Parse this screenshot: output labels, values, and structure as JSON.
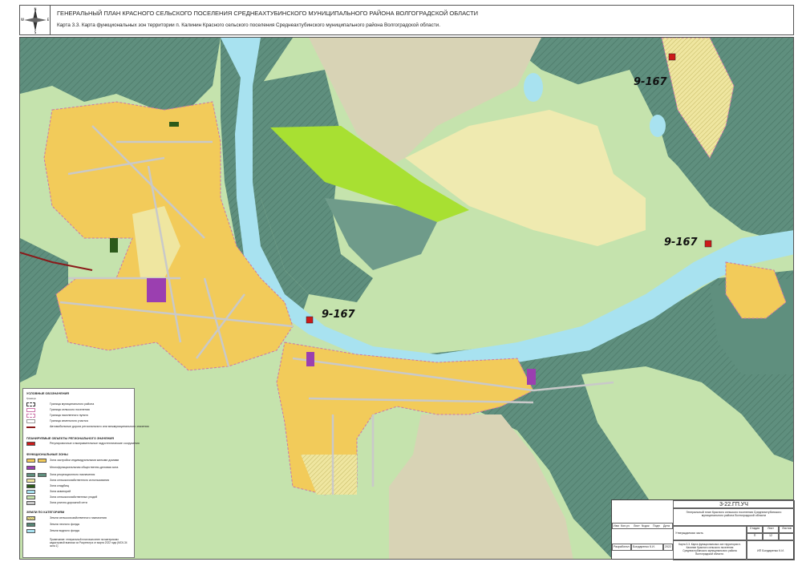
{
  "header": {
    "title": "ГЕНЕРАЛЬНЫЙ ПЛАН КРАСНОГО СЕЛЬСКОГО ПОСЕЛЕНИЯ СРЕДНЕАХТУБИНСКОГО МУНИЦИПАЛЬНОГО РАЙОНА ВОЛГОГРАДСКОЙ ОБЛАСТИ",
    "subtitle": "Карта 3.3. Карта функциональных зон территории п. Калинин Красного сельского поселения Среднеахтубинского муниципального района Волгоградской области."
  },
  "compass": {
    "n": "N",
    "s": "S",
    "e": "E",
    "w": "W"
  },
  "road_labels": [
    "9-167",
    "9-167",
    "9-167"
  ],
  "legend": {
    "title": "УСЛОВНЫЕ ОБОЗНАЧЕНИЯ",
    "sub": "Граница",
    "boundaries": [
      "Граница муниципального района",
      "Граница сельского поселения",
      "Граница населенного пункта",
      "Граница земельного участка",
      "Автомобильные дороги регионального или межмуниципального значения"
    ],
    "planned_title": "ПЛАНИРУЕМЫЕ ОБЪЕКТЫ РЕГИОНАЛЬНОГО ЗНАЧЕНИЯ",
    "planned": [
      "Регулировочные и выправительные гидротехнические сооружения"
    ],
    "zones_title": "ФУНКЦИОНАЛЬНЫЕ ЗОНЫ",
    "zones": [
      "Зона застройки индивидуальными жилыми домами",
      "Многофункциональная общественно-деловая зона",
      "Зона рекреационного назначения",
      "Зона сельскохозяйственного использования",
      "Зона кладбищ",
      "Зона акваторий",
      "Зона сельскохозяйственных угодий",
      "Зона улично-дорожной сети"
    ],
    "categories_title": "ЗЕМЛИ ПО КАТЕГОРИЯМ",
    "categories": [
      "Земли сельскохозяйственного назначения",
      "Земли лесного фонда",
      "Земли водного фонда"
    ],
    "note": "Примечание: генеральный план выполнен на материалах кадастровой выписки из Росреестра от марта 2022 года (МСК-34 зона 1)"
  },
  "stamp": {
    "code": "3-22.ГП.УЧ",
    "project": "Генеральный план Красного сельского поселения Среднеахтубинского муниципального района Волгоградской области",
    "cols": [
      "Изм",
      "Кол.уч",
      "Лист",
      "№док",
      "Подп",
      "Дата"
    ],
    "part": "Утверждаемая часть",
    "stage_headers": [
      "Стадия",
      "Лист",
      "Листов"
    ],
    "stage_values": [
      "П",
      "12",
      ""
    ],
    "developer_label": "Разработал",
    "developer_name": "Бондаренко К.И.",
    "year": "2022",
    "sheet_title": "Карта 3.3. Карта функциональных зон территории п. Калинин Красного сельского поселения Среднеахтубинского муниципального района Волгоградской области.",
    "org": "ИП Бондаренко К.И."
  },
  "colors": {
    "water": "#a8e2f0",
    "forest": "#5f8f7e",
    "agri_land": "#c5e3ad",
    "residential": "#f2cb5a",
    "field": "#efeab0",
    "public": "#9b3fb0",
    "bright_green": "#a8e032",
    "road": "#c9c9c9"
  }
}
